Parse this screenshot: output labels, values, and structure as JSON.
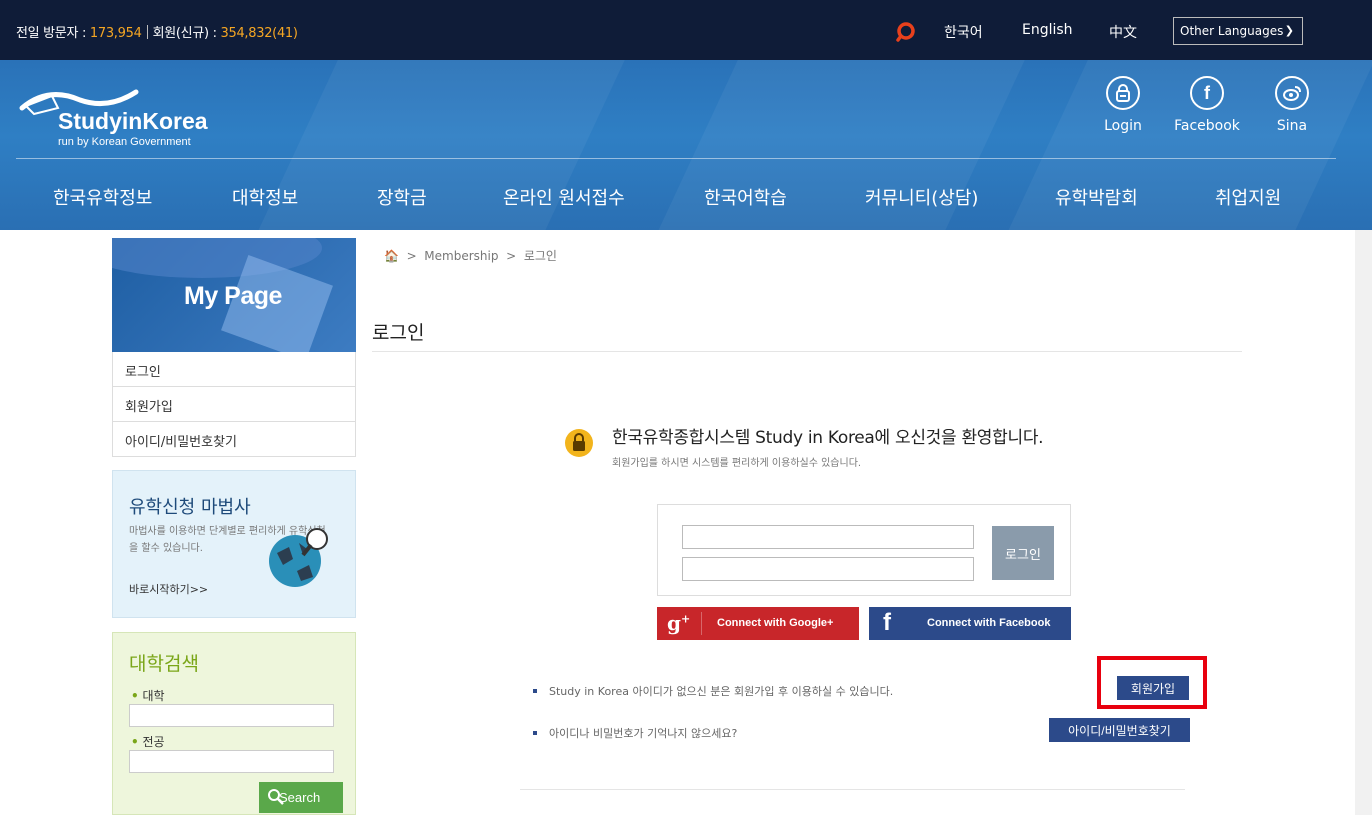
{
  "topbar": {
    "visitors_label": "전일 방문자 :",
    "visitors_value": "173,954",
    "members_label": "회원(신규) :",
    "members_value": "354,832(41)",
    "languages": [
      "한국어",
      "English",
      "中文"
    ],
    "other_languages": "Other Languages"
  },
  "header": {
    "logo_title": "StudyinKorea",
    "logo_sub": "run by Korean Government",
    "social": [
      {
        "label": "Login",
        "icon": "lock-icon"
      },
      {
        "label": "Facebook",
        "icon": "facebook-icon"
      },
      {
        "label": "Sina",
        "icon": "sina-weibo-icon"
      }
    ],
    "nav": [
      "한국유학정보",
      "대학정보",
      "장학금",
      "온라인 원서접수",
      "한국어학습",
      "커뮤니티(상담)",
      "유학박람회",
      "취업지원"
    ]
  },
  "sidebar": {
    "title": "My Page",
    "items": [
      "로그인",
      "회원가입",
      "아이디/비밀번호찾기"
    ],
    "wizard": {
      "title": "유학신청 마법사",
      "desc": "마법사를 이용하면 단계별로 편리하게 유학신청을 할수 있습니다.",
      "link": "바로시작하기>>"
    },
    "uni_search": {
      "title": "대학검색",
      "university_label": "대학",
      "major_label": "전공",
      "button": "Search"
    }
  },
  "main": {
    "breadcrumb": {
      "sep": ">",
      "membership": "Membership",
      "current": "로그인"
    },
    "title": "로그인",
    "welcome": "한국유학종합시스템 Study in Korea에 오신것을 환영합니다.",
    "welcome_sub": "회원가입를 하시면 시스템를 편리하게 이용하실수 있습니다.",
    "login_button": "로그인",
    "google_button": "Connect with Google+",
    "facebook_button": "Connect with Facebook",
    "note_signup": "Study in Korea 아이디가 없으신 분은 회원가입 후 이용하실 수 있습니다.",
    "signup_button": "회원가입",
    "note_find": "아이디나 비밀번호가 기억나지 않으세요?",
    "find_button": "아이디/비밀번호찾기"
  },
  "colors": {
    "topbar": "#0f1c38",
    "accent_orange": "#f5a623",
    "header_blue": "#2f7fc4",
    "navy_button": "#2c4a8a",
    "google_red": "#c8262a",
    "highlight_red": "#e8000e",
    "search_green": "#5aa84a"
  }
}
